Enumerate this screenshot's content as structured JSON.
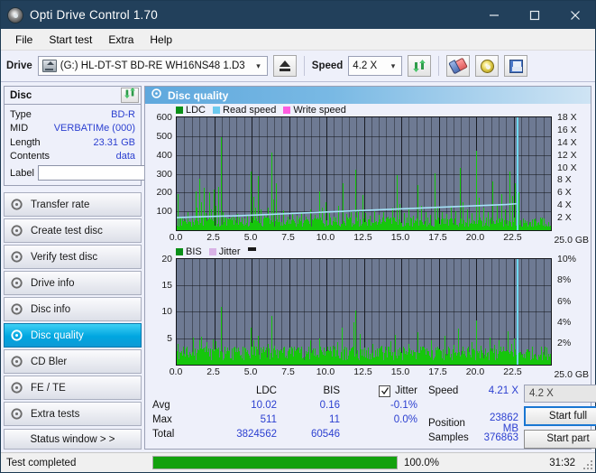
{
  "window": {
    "title": "Opti Drive Control 1.70",
    "app_icon": "disc-icon",
    "minimize": "minimize-icon",
    "maximize": "maximize-icon",
    "close": "close-icon"
  },
  "menu": {
    "items": [
      "File",
      "Start test",
      "Extra",
      "Help"
    ]
  },
  "toolbar": {
    "drive_label": "Drive",
    "drive_value": "(G:)  HL-DT-ST BD-RE  WH16NS48 1.D3",
    "eject_icon": "eject-icon",
    "speed_label": "Speed",
    "speed_value": "4.2 X",
    "refresh_icon": "refresh-icon",
    "erase_icon": "eraser-icon",
    "disc_icon": "disc-icon",
    "save_icon": "save-icon"
  },
  "disc": {
    "header": "Disc",
    "refresh_icon": "refresh-icon",
    "rows": [
      {
        "key": "Type",
        "value": "BD-R"
      },
      {
        "key": "MID",
        "value": "VERBATIMe (000)"
      },
      {
        "key": "Length",
        "value": "23.31 GB"
      },
      {
        "key": "Contents",
        "value": "data"
      }
    ],
    "label_key": "Label",
    "label_value": "",
    "label_placeholder": "",
    "label_button_icon": "disc-icon"
  },
  "sidebar": {
    "items": [
      {
        "label": "Transfer rate",
        "icon": "disc-icon",
        "active": false
      },
      {
        "label": "Create test disc",
        "icon": "disc-icon",
        "active": false
      },
      {
        "label": "Verify test disc",
        "icon": "disc-icon",
        "active": false
      },
      {
        "label": "Drive info",
        "icon": "disc-icon",
        "active": false
      },
      {
        "label": "Disc info",
        "icon": "disc-icon",
        "active": false
      },
      {
        "label": "Disc quality",
        "icon": "disc-icon",
        "active": true
      },
      {
        "label": "CD Bler",
        "icon": "disc-icon",
        "active": false
      },
      {
        "label": "FE / TE",
        "icon": "disc-icon",
        "active": false
      },
      {
        "label": "Extra tests",
        "icon": "disc-icon",
        "active": false
      }
    ],
    "status_window": "Status window > >"
  },
  "content": {
    "header_title": "Disc quality",
    "header_icon": "disc-icon"
  },
  "colors": {
    "ldc": "#16c60c",
    "bis": "#16c60c",
    "read_speed": "#a5e2f7",
    "write_speed": "#ff5ce0",
    "jitter": "#d9b3e6",
    "plot_bg": "#6e7a93",
    "accent": "#00a6e0",
    "value_text": "#2b3fd0",
    "progress": "#13a10e"
  },
  "chart_data": [
    {
      "type": "bar",
      "title": "LDC / speed vs disc position",
      "legend": [
        {
          "label": "LDC",
          "color": "#16c60c"
        },
        {
          "label": "Read speed",
          "color": "#a5e2f7"
        },
        {
          "label": "Write speed",
          "color": "#ff5ce0"
        }
      ],
      "legend_position": "top-left",
      "grid": true,
      "xlabel": "GB",
      "x_unit": "25.0 GB",
      "xlim": [
        0,
        25
      ],
      "xticks": [
        "0.0",
        "2.5",
        "5.0",
        "7.5",
        "10.0",
        "12.5",
        "15.0",
        "17.5",
        "20.0",
        "22.5"
      ],
      "xtick_values": [
        0,
        2.5,
        5,
        7.5,
        10,
        12.5,
        15,
        17.5,
        20,
        22.5
      ],
      "ylabel": "LDC",
      "ylim": [
        0,
        600
      ],
      "yticks": [
        100,
        200,
        300,
        400,
        500,
        600
      ],
      "y2label": "Speed",
      "y2lim": [
        0,
        18
      ],
      "y2ticks": [
        "2 X",
        "4 X",
        "6 X",
        "8 X",
        "10 X",
        "12 X",
        "14 X",
        "16 X",
        "18 X"
      ],
      "y2tick_values": [
        2,
        4,
        6,
        8,
        10,
        12,
        14,
        16,
        18
      ],
      "marker_x": 22.7,
      "series": [
        {
          "name": "LDC",
          "color": "#16c60c",
          "baseline": 35,
          "peaks": [
            [
              0.05,
              190
            ],
            [
              0.35,
              70
            ],
            [
              0.7,
              95
            ],
            [
              1.0,
              60
            ],
            [
              1.25,
              205
            ],
            [
              1.35,
              120
            ],
            [
              1.5,
              275
            ],
            [
              1.62,
              150
            ],
            [
              1.8,
              225
            ],
            [
              1.95,
              90
            ],
            [
              2.15,
              200
            ],
            [
              2.3,
              110
            ],
            [
              2.45,
              215
            ],
            [
              2.6,
              130
            ],
            [
              2.75,
              230
            ],
            [
              2.95,
              495
            ],
            [
              3.1,
              95
            ],
            [
              3.4,
              60
            ],
            [
              3.75,
              70
            ],
            [
              4.05,
              85
            ],
            [
              4.35,
              65
            ],
            [
              4.7,
              75
            ],
            [
              4.95,
              310
            ],
            [
              5.1,
              175
            ],
            [
              5.25,
              120
            ],
            [
              5.45,
              285
            ],
            [
              5.6,
              110
            ],
            [
              5.85,
              80
            ],
            [
              6.1,
              120
            ],
            [
              6.3,
              410
            ],
            [
              6.45,
              160
            ],
            [
              6.6,
              250
            ],
            [
              6.8,
              90
            ],
            [
              7.1,
              105
            ],
            [
              7.4,
              70
            ],
            [
              7.7,
              85
            ],
            [
              8.0,
              75
            ],
            [
              8.3,
              95
            ],
            [
              8.6,
              70
            ],
            [
              8.9,
              110
            ],
            [
              9.2,
              80
            ],
            [
              9.5,
              205
            ],
            [
              9.7,
              120
            ],
            [
              9.95,
              150
            ],
            [
              10.2,
              90
            ],
            [
              10.5,
              70
            ],
            [
              10.8,
              130
            ],
            [
              11.1,
              250
            ],
            [
              11.3,
              85
            ],
            [
              11.6,
              95
            ],
            [
              11.9,
              320
            ],
            [
              12.1,
              110
            ],
            [
              12.4,
              185
            ],
            [
              12.6,
              90
            ],
            [
              12.9,
              75
            ],
            [
              13.2,
              100
            ],
            [
              13.5,
              80
            ],
            [
              13.8,
              95
            ],
            [
              14.1,
              70
            ],
            [
              14.4,
              120
            ],
            [
              14.7,
              290
            ],
            [
              14.9,
              140
            ],
            [
              15.2,
              90
            ],
            [
              15.5,
              110
            ],
            [
              15.8,
              75
            ],
            [
              16.1,
              240
            ],
            [
              16.3,
              130
            ],
            [
              16.6,
              95
            ],
            [
              16.9,
              80
            ],
            [
              17.2,
              300
            ],
            [
              17.4,
              120
            ],
            [
              17.7,
              95
            ],
            [
              18.0,
              85
            ],
            [
              18.3,
              130
            ],
            [
              18.6,
              100
            ],
            [
              18.9,
              330
            ],
            [
              19.1,
              150
            ],
            [
              19.4,
              110
            ],
            [
              19.7,
              90
            ],
            [
              20.0,
              420
            ],
            [
              20.2,
              170
            ],
            [
              20.5,
              120
            ],
            [
              20.8,
              95
            ],
            [
              21.1,
              260
            ],
            [
              21.4,
              140
            ],
            [
              21.7,
              190
            ],
            [
              21.9,
              110
            ],
            [
              22.2,
              310
            ],
            [
              22.4,
              180
            ],
            [
              22.6,
              250
            ],
            [
              22.75,
              240
            ],
            [
              22.85,
              200
            ]
          ]
        },
        {
          "name": "Read speed",
          "color": "#a5e2f7",
          "points": [
            [
              0.0,
              2.0
            ],
            [
              1.0,
              2.1
            ],
            [
              2.5,
              2.2
            ],
            [
              4.0,
              2.3
            ],
            [
              6.0,
              2.5
            ],
            [
              8.0,
              2.7
            ],
            [
              10.0,
              2.9
            ],
            [
              12.0,
              3.1
            ],
            [
              14.0,
              3.3
            ],
            [
              16.0,
              3.5
            ],
            [
              18.0,
              3.7
            ],
            [
              20.0,
              3.9
            ],
            [
              22.0,
              4.1
            ],
            [
              22.7,
              4.21
            ]
          ]
        }
      ]
    },
    {
      "type": "bar",
      "title": "BIS / jitter vs disc position",
      "legend": [
        {
          "label": "BIS",
          "color": "#16c60c"
        },
        {
          "label": "Jitter",
          "color": "#d9b3e6"
        }
      ],
      "legend_position": "top-left",
      "grid": true,
      "xlabel": "GB",
      "x_unit": "25.0 GB",
      "xlim": [
        0,
        25
      ],
      "xticks": [
        "0.0",
        "2.5",
        "5.0",
        "7.5",
        "10.0",
        "12.5",
        "15.0",
        "17.5",
        "20.0",
        "22.5"
      ],
      "xtick_values": [
        0,
        2.5,
        5,
        7.5,
        10,
        12.5,
        15,
        17.5,
        20,
        22.5
      ],
      "ylabel": "BIS",
      "ylim": [
        0,
        20
      ],
      "yticks": [
        5,
        10,
        15,
        20
      ],
      "y2label": "Jitter",
      "y2lim": [
        0,
        10
      ],
      "y2ticks": [
        "2%",
        "4%",
        "6%",
        "8%",
        "10%"
      ],
      "y2tick_values": [
        2,
        4,
        6,
        8,
        10
      ],
      "marker_x": 22.7,
      "series": [
        {
          "name": "BIS",
          "color": "#16c60c",
          "baseline": 1.8,
          "peaks": [
            [
              0.05,
              4.0
            ],
            [
              0.3,
              2.6
            ],
            [
              0.6,
              3.0
            ],
            [
              0.85,
              2.4
            ],
            [
              1.1,
              5.2
            ],
            [
              1.2,
              3.0
            ],
            [
              1.35,
              2.2
            ],
            [
              1.5,
              4.6
            ],
            [
              1.65,
              5.3
            ],
            [
              1.8,
              3.2
            ],
            [
              2.0,
              4.2
            ],
            [
              2.2,
              3.0
            ],
            [
              2.4,
              4.8
            ],
            [
              2.6,
              4.4
            ],
            [
              2.8,
              3.2
            ],
            [
              2.95,
              11.0
            ],
            [
              3.2,
              2.8
            ],
            [
              3.5,
              2.4
            ],
            [
              3.8,
              3.0
            ],
            [
              4.1,
              2.6
            ],
            [
              4.4,
              3.4
            ],
            [
              4.7,
              2.8
            ],
            [
              4.95,
              7.0
            ],
            [
              5.15,
              4.6
            ],
            [
              5.4,
              5.4
            ],
            [
              5.6,
              3.2
            ],
            [
              5.9,
              2.8
            ],
            [
              6.1,
              4.0
            ],
            [
              6.3,
              9.2
            ],
            [
              6.5,
              3.6
            ],
            [
              6.8,
              2.8
            ],
            [
              7.1,
              3.2
            ],
            [
              7.4,
              2.6
            ],
            [
              7.7,
              3.0
            ],
            [
              8.0,
              2.8
            ],
            [
              8.3,
              3.4
            ],
            [
              8.6,
              2.6
            ],
            [
              8.9,
              4.6
            ],
            [
              9.2,
              3.0
            ],
            [
              9.5,
              5.0
            ],
            [
              9.8,
              3.2
            ],
            [
              10.1,
              2.8
            ],
            [
              10.4,
              3.6
            ],
            [
              10.7,
              4.2
            ],
            [
              11.0,
              7.0
            ],
            [
              11.2,
              3.4
            ],
            [
              11.5,
              2.8
            ],
            [
              11.8,
              8.0
            ],
            [
              11.95,
              10.2
            ],
            [
              12.2,
              5.8
            ],
            [
              12.5,
              3.2
            ],
            [
              12.8,
              2.8
            ],
            [
              13.1,
              4.0
            ],
            [
              13.4,
              3.0
            ],
            [
              13.7,
              3.6
            ],
            [
              14.0,
              2.8
            ],
            [
              14.3,
              4.4
            ],
            [
              14.6,
              5.6
            ],
            [
              14.9,
              3.2
            ],
            [
              15.2,
              3.0
            ],
            [
              15.5,
              4.0
            ],
            [
              15.8,
              2.8
            ],
            [
              16.1,
              6.2
            ],
            [
              16.4,
              3.4
            ],
            [
              16.7,
              3.0
            ],
            [
              17.0,
              4.6
            ],
            [
              17.3,
              3.2
            ],
            [
              17.6,
              2.8
            ],
            [
              17.9,
              5.4
            ],
            [
              18.2,
              3.0
            ],
            [
              18.5,
              3.8
            ],
            [
              18.8,
              6.8
            ],
            [
              19.1,
              3.4
            ],
            [
              19.4,
              3.0
            ],
            [
              19.7,
              4.2
            ],
            [
              20.0,
              8.4
            ],
            [
              20.3,
              3.6
            ],
            [
              20.6,
              3.0
            ],
            [
              20.9,
              5.2
            ],
            [
              21.2,
              3.8
            ],
            [
              21.5,
              4.6
            ],
            [
              21.8,
              3.4
            ],
            [
              22.1,
              6.4
            ],
            [
              22.35,
              4.0
            ],
            [
              22.55,
              5.0
            ],
            [
              22.7,
              4.4
            ]
          ]
        }
      ]
    }
  ],
  "stats": {
    "col_headers": {
      "ldc": "LDC",
      "bis": "BIS",
      "jitter": "Jitter"
    },
    "jitter_checked": true,
    "jitter_checkbox_icon": "checkbox-checked-icon",
    "rows": [
      {
        "label": "Avg",
        "ldc": "10.02",
        "bis": "0.16",
        "jitter": "-0.1%"
      },
      {
        "label": "Max",
        "ldc": "511",
        "bis": "11",
        "jitter": "0.0%"
      },
      {
        "label": "Total",
        "ldc": "3824562",
        "bis": "60546",
        "jitter": ""
      }
    ]
  },
  "results": {
    "speed_key": "Speed",
    "speed_value": "4.21 X",
    "position_key": "Position",
    "position_value": "23862 MB",
    "samples_key": "Samples",
    "samples_value": "376863",
    "speed_select": "4.2 X",
    "start_full": "Start full",
    "start_part": "Start part"
  },
  "statusbar": {
    "text": "Test completed",
    "percent": "100.0%",
    "progress_value": 100,
    "time": "31:32"
  }
}
